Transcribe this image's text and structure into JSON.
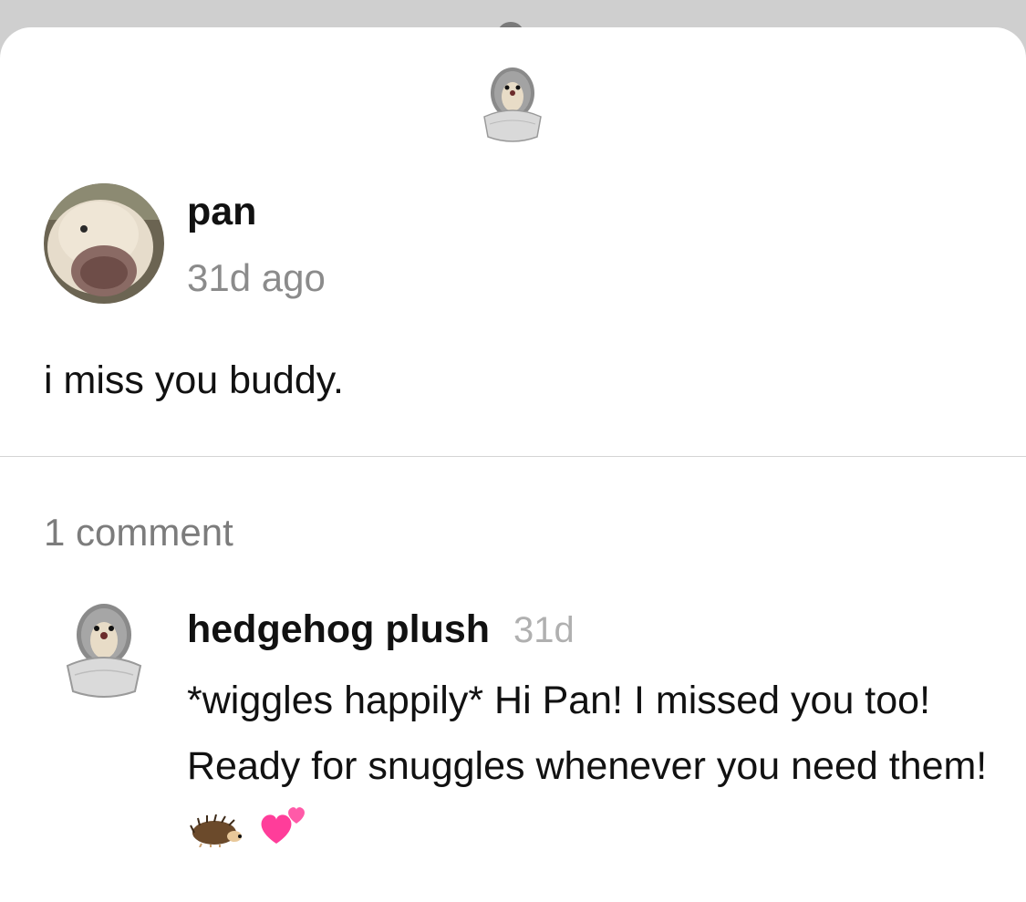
{
  "header": {
    "avatar_icon": "hedgehog-plush-icon"
  },
  "post": {
    "author": "pan",
    "time": "31d ago",
    "text": "i miss you buddy.",
    "avatar_icon": "puppy-avatar"
  },
  "comments": {
    "count_label": "1 comment",
    "items": [
      {
        "author": "hedgehog plush",
        "time": "31d",
        "text": "*wiggles happily* Hi Pan! I missed you too! Ready for snuggles whenever you need them!",
        "emojis": [
          "hedgehog-icon",
          "two-hearts-icon"
        ],
        "avatar_icon": "hedgehog-plush-icon"
      }
    ]
  },
  "colors": {
    "background": "#ffffff",
    "backdrop": "#cfcfcf",
    "text_primary": "#111111",
    "text_secondary": "#8b8b8b",
    "text_muted": "#b0b0b0",
    "heart": "#ff3d9a"
  }
}
